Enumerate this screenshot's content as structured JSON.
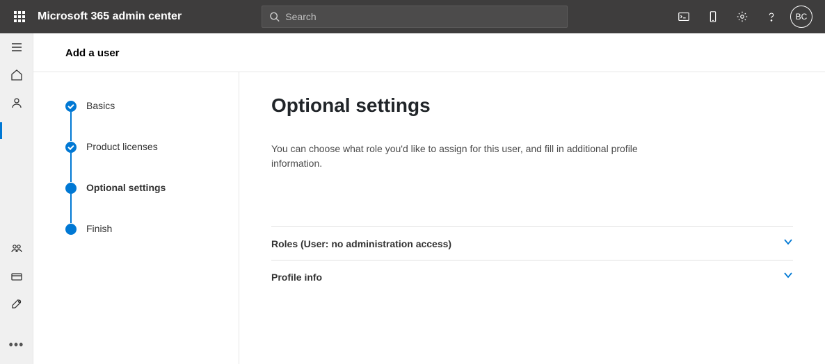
{
  "header": {
    "app_title": "Microsoft 365 admin center",
    "search_placeholder": "Search",
    "avatar_initials": "BC"
  },
  "panel": {
    "title": "Add a user"
  },
  "steps": [
    {
      "label": "Basics",
      "state": "done"
    },
    {
      "label": "Product licenses",
      "state": "done"
    },
    {
      "label": "Optional settings",
      "state": "current"
    },
    {
      "label": "Finish",
      "state": "upcoming"
    }
  ],
  "content": {
    "heading": "Optional settings",
    "description": "You can choose what role you'd like to assign for this user, and fill in additional profile information.",
    "expanders": [
      {
        "label": "Roles (User: no administration access)"
      },
      {
        "label": "Profile info"
      }
    ]
  }
}
